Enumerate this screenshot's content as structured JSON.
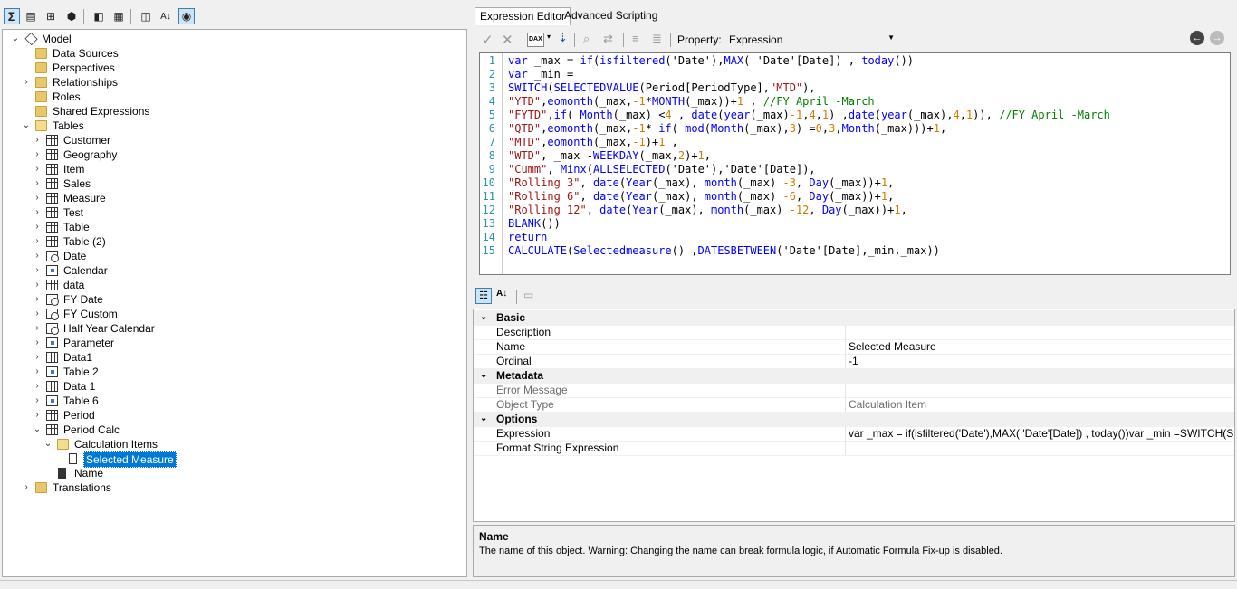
{
  "tabs": {
    "expression_editor": "Expression Editor",
    "advanced_scripting": "Advanced Scripting"
  },
  "editor_toolbar": {
    "property_label": "Property:",
    "property_value": "Expression",
    "dax_label": "DAX"
  },
  "tree": {
    "root": "Model",
    "items": [
      "Data Sources",
      "Perspectives",
      "Relationships",
      "Roles",
      "Shared Expressions",
      "Tables",
      "Customer",
      "Geography",
      "Item",
      "Sales",
      "Measure",
      "Test",
      "Table",
      "Table (2)",
      "Date",
      "Calendar",
      "data",
      "FY Date",
      "FY Custom",
      "Half Year Calendar",
      "Parameter",
      "Data1",
      "Table 2",
      "Data 1",
      "Table 6",
      "Period",
      "Period Calc",
      "Calculation Items",
      "Selected Measure",
      "Name",
      "Translations"
    ]
  },
  "code": {
    "line_numbers": [
      "1",
      "2",
      "3",
      "4",
      "5",
      "6",
      "7",
      "8",
      "9",
      "10",
      "11",
      "12",
      "13",
      "14",
      "15"
    ],
    "lines": [
      "var _max = if(isfiltered('Date'),MAX( 'Date'[Date]) , today())",
      "var _min =",
      "SWITCH(SELECTEDVALUE(Period[PeriodType],\"MTD\"),",
      "\"YTD\",eomonth(_max,-1*MONTH(_max))+1 , //FY April -March",
      "\"FYTD\",if( Month(_max) <4 , date(year(_max)-1,4,1) ,date(year(_max),4,1)), //FY April -March",
      "\"QTD\",eomonth(_max,-1* if( mod(Month(_max),3) =0,3,Month(_max)))+1,",
      "\"MTD\",eomonth(_max,-1)+1 ,",
      "\"WTD\", _max -WEEKDAY(_max,2)+1,",
      "\"Cumm\", Minx(ALLSELECTED('Date'),'Date'[Date]),",
      "\"Rolling 3\", date(Year(_max), month(_max) -3, Day(_max))+1,",
      "\"Rolling 6\", date(Year(_max), month(_max) -6, Day(_max))+1,",
      "\"Rolling 12\", date(Year(_max), month(_max) -12, Day(_max))+1,",
      "BLANK())",
      "return",
      "CALCULATE(Selectedmeasure() ,DATESBETWEEN('Date'[Date],_min,_max))"
    ]
  },
  "properties": {
    "basic": {
      "label": "Basic",
      "description": "Description",
      "name": "Name",
      "name_value": "Selected Measure",
      "ordinal": "Ordinal",
      "ordinal_value": "-1"
    },
    "metadata": {
      "label": "Metadata",
      "error_message": "Error Message",
      "object_type": "Object Type",
      "object_type_value": "Calculation Item"
    },
    "options": {
      "label": "Options",
      "expression": "Expression",
      "expression_value": "var _max = if(isfiltered('Date'),MAX( 'Date'[Date]) , today())var _min =SWITCH(SELECTEDVALUE(Period",
      "format_string": "Format String Expression"
    }
  },
  "description_panel": {
    "title": "Name",
    "text": "The name of this object. Warning: Changing the name can break formula logic, if Automatic Formula Fix-up is disabled."
  }
}
